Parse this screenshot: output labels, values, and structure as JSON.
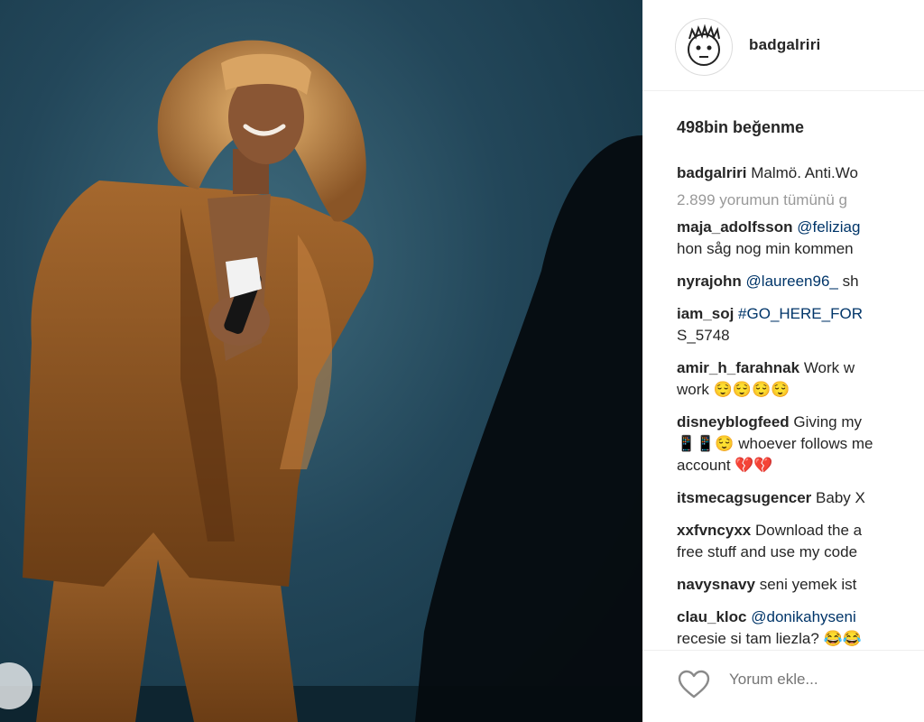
{
  "post": {
    "username": "badgalriri",
    "likes": "498bin beğenme",
    "caption": {
      "user": "badgalriri",
      "text": "Malmö. Anti.Wo"
    },
    "view_all_comments": "2.899 yorumun tümünü g",
    "comments": [
      {
        "user": "maja_adolfsson",
        "tag": "@feliziag",
        "lines": [
          "hon såg nog min kommen"
        ]
      },
      {
        "user": "nyrajohn",
        "tag": "@laureen96_",
        "text": "sh"
      },
      {
        "user": "iam_soj",
        "tag": "#GO_HERE_FOR",
        "tag_lines": [
          "S_5748"
        ]
      },
      {
        "user": "amir_h_farahnak",
        "text": "Work w",
        "lines": [
          "work 😌😌😌😌"
        ]
      },
      {
        "user": "disneyblogfeed",
        "text": "Giving my",
        "lines": [
          "📱📱😌 whoever follows me",
          "account 💔💔"
        ]
      },
      {
        "user": "itsmecagsugencer",
        "text": "Baby X"
      },
      {
        "user": "xxfvncyxx",
        "text": "Download the a",
        "lines": [
          "free stuff and use my code"
        ]
      },
      {
        "user": "navysnavy",
        "text": "seni yemek ist"
      },
      {
        "user": "clau_kloc",
        "tag": "@donikahyseni",
        "lines": [
          "recesie si tam liezla? 😂😂"
        ]
      }
    ],
    "add_comment_placeholder": "Yorum ekle..."
  },
  "icons": {
    "like": "heart-outline-icon",
    "avatar": "cartoon-face-avatar"
  },
  "colors": {
    "link": "#003569",
    "muted": "#999999",
    "text": "#262626"
  }
}
